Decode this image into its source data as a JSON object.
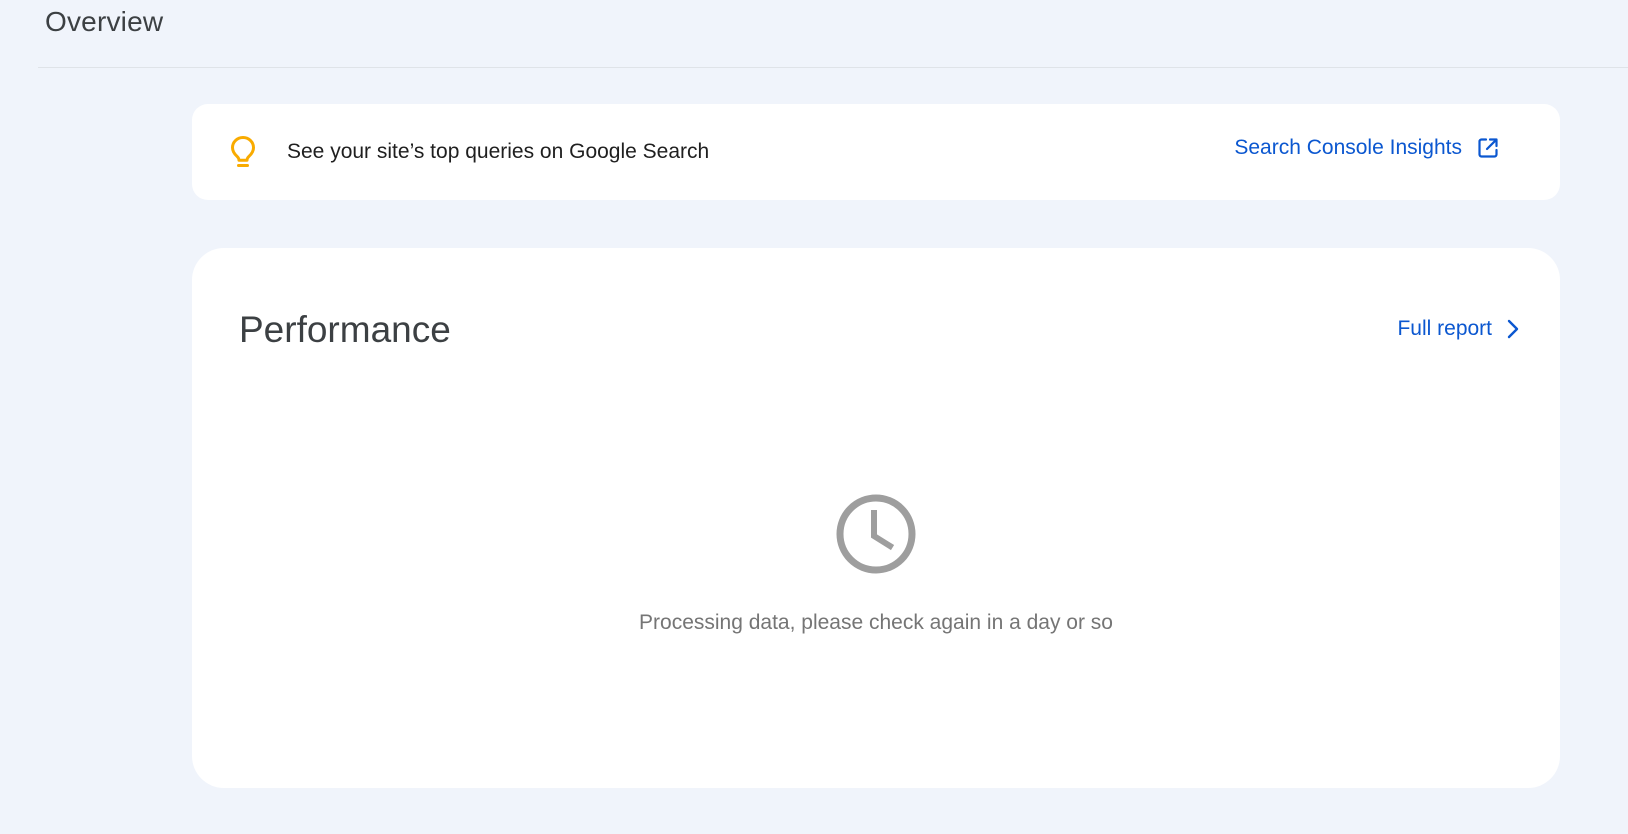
{
  "header": {
    "title": "Overview"
  },
  "tip": {
    "icon": "lightbulb-icon",
    "text": "See your site’s top queries on Google Search",
    "link_label": "Search Console Insights",
    "link_icon": "open-in-new-icon"
  },
  "performance": {
    "title": "Performance",
    "full_report_label": "Full report",
    "full_report_icon": "chevron-right-icon",
    "empty_icon": "clock-icon",
    "empty_message": "Processing data, please check again in a day or so"
  },
  "colors": {
    "background": "#f0f4fb",
    "card": "#ffffff",
    "link": "#0b57d0",
    "tip_icon": "#f9ab00",
    "muted": "#757575"
  }
}
